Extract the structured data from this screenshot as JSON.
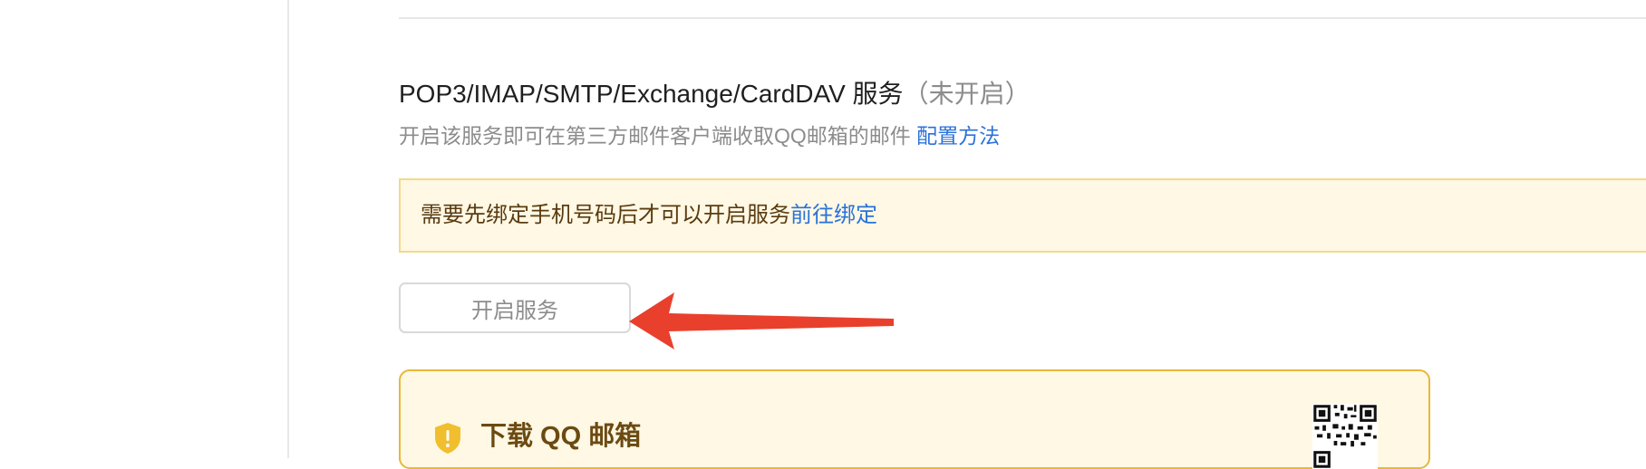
{
  "service": {
    "title": "POP3/IMAP/SMTP/Exchange/CardDAV 服务",
    "status": "（未开启）",
    "description": "开启该服务即可在第三方邮件客户端收取QQ邮箱的邮件",
    "config_link": "配置方法"
  },
  "notice": {
    "text": "需要先绑定手机号码后才可以开启服务",
    "link": "前往绑定"
  },
  "enable_button": {
    "label": "开启服务",
    "disabled": true
  },
  "download_card": {
    "title": "下载 QQ 邮箱",
    "icons": [
      "shield-icon",
      "qr-code-icon"
    ]
  },
  "annotation": {
    "icon": "red-arrow-icon",
    "color": "#e8402c"
  },
  "colors": {
    "notice_bg": "#fff8e4",
    "notice_border": "#f4d98a",
    "link": "#2a72d8",
    "card_border": "#e8b83a",
    "shield": "#f1be2e"
  }
}
